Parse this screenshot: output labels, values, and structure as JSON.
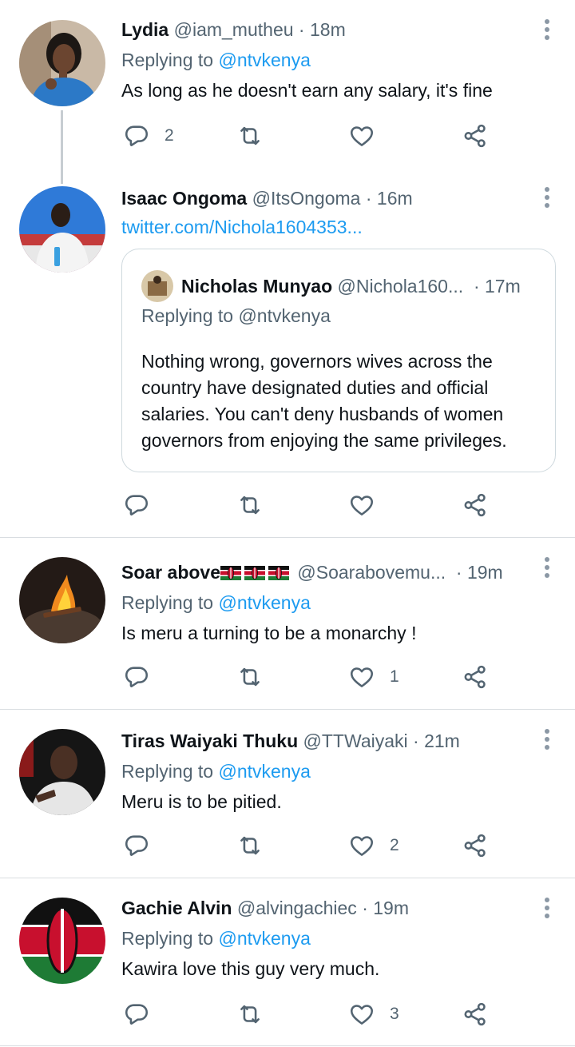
{
  "tweets": [
    {
      "name": "Lydia",
      "handle": "@iam_mutheu",
      "time": "18m",
      "replying_label": "Replying to",
      "replying_to": "@ntvkenya",
      "text": "As long as he doesn't earn any salary, it's fine",
      "replies": "2",
      "retweets": "",
      "likes": ""
    },
    {
      "name": "Isaac Ongoma",
      "handle": "@ItsOngoma",
      "time": "16m",
      "link": "twitter.com/Nichola1604353...",
      "quote": {
        "name": "Nicholas Munyao",
        "handle": "@Nichola160...",
        "time": "17m",
        "replying": "Replying to @ntvkenya",
        "text": "Nothing wrong, governors wives across the country have designated duties and official salaries. You can't deny husbands of women governors from enjoying the same privileges."
      },
      "replies": "",
      "retweets": "",
      "likes": ""
    },
    {
      "name": "Soar above",
      "handle": "@Soarabovemu...",
      "time": "19m",
      "replying_label": "Replying to",
      "replying_to": "@ntvkenya",
      "text": "Is meru a turning to be a monarchy !",
      "replies": "",
      "retweets": "",
      "likes": "1"
    },
    {
      "name": "Tiras Waiyaki Thuku",
      "handle": "@TTWaiyaki",
      "time": "21m",
      "replying_label": "Replying to",
      "replying_to": "@ntvkenya",
      "text": "Meru is to be pitied.",
      "replies": "",
      "retweets": "",
      "likes": "2"
    },
    {
      "name": "Gachie Alvin",
      "handle": "@alvingachiec",
      "time": "19m",
      "replying_label": "Replying to",
      "replying_to": "@ntvkenya",
      "text": "Kawira love this guy very much.",
      "replies": "",
      "retweets": "",
      "likes": "3"
    }
  ],
  "separator": "·",
  "icons": {
    "reply": "reply-icon",
    "retweet": "retweet-icon",
    "like": "heart-icon",
    "share": "share-icon",
    "more": "more-vertical-icon",
    "flag": "kenya-flag-emoji"
  },
  "colors": {
    "link": "#1d9bf0",
    "secondary_text": "#536471",
    "primary_text": "#0f1419",
    "divider": "#d9dde1"
  }
}
